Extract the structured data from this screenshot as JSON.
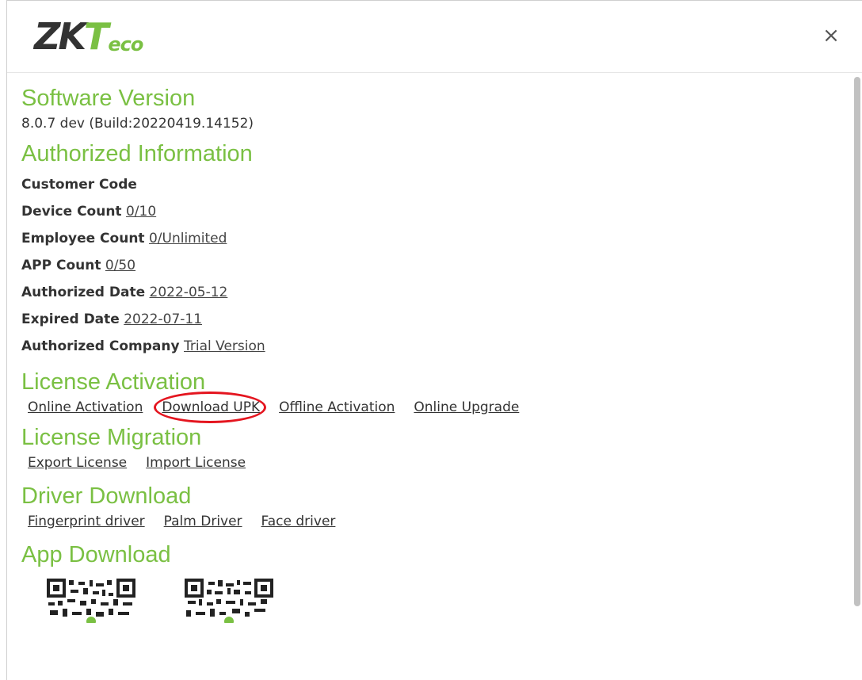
{
  "brand": {
    "zk": "ZK",
    "t": "T",
    "eco": "eco"
  },
  "dialog": {
    "close_glyph": "×"
  },
  "software_version": {
    "title": "Software Version",
    "value": "8.0.7 dev (Build:20220419.14152)"
  },
  "authorized_information": {
    "title": "Authorized Information",
    "rows": [
      {
        "label": "Customer Code",
        "value": ""
      },
      {
        "label": "Device Count",
        "value": "0/10"
      },
      {
        "label": "Employee Count",
        "value": "0/Unlimited"
      },
      {
        "label": "APP Count",
        "value": "0/50"
      },
      {
        "label": "Authorized Date",
        "value": "2022-05-12"
      },
      {
        "label": "Expired Date",
        "value": "2022-07-11"
      },
      {
        "label": "Authorized Company",
        "value": "Trial Version"
      }
    ]
  },
  "license_activation": {
    "title": "License Activation",
    "links": [
      "Online Activation",
      "Download UPK",
      "Offline Activation",
      "Online Upgrade"
    ]
  },
  "license_migration": {
    "title": "License Migration",
    "links": [
      "Export License",
      "Import License"
    ]
  },
  "driver_download": {
    "title": "Driver Download",
    "links": [
      "Fingerprint driver",
      "Palm Driver",
      "Face driver"
    ]
  },
  "app_download": {
    "title": "App Download"
  },
  "colors": {
    "accent": "#7ac043",
    "highlight": "#e4151f",
    "text": "#333333"
  }
}
